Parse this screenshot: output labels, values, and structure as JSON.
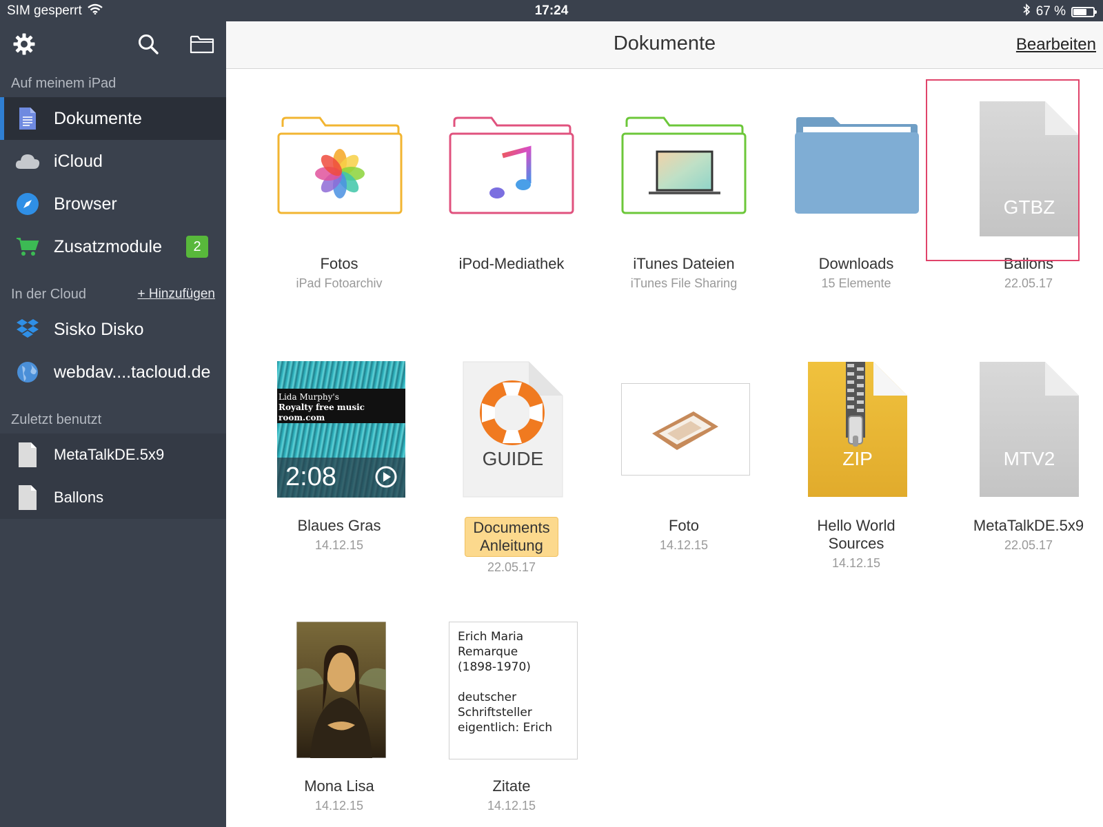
{
  "status_bar": {
    "carrier": "SIM gesperrt",
    "time": "17:24",
    "battery": "67 %",
    "battery_level": 0.67
  },
  "sidebar": {
    "section_local": "Auf meinem iPad",
    "items": [
      {
        "label": "Dokumente",
        "icon": "document-icon"
      },
      {
        "label": "iCloud",
        "icon": "cloud-icon"
      },
      {
        "label": "Browser",
        "icon": "compass-icon"
      },
      {
        "label": "Zusatzmodule",
        "icon": "cart-icon",
        "badge": "2"
      }
    ],
    "section_cloud": "In der Cloud",
    "add_label": "+ Hinzufügen",
    "cloud_items": [
      {
        "label": "Sisko Disko",
        "icon": "dropbox-icon"
      },
      {
        "label": "webdav....tacloud.de",
        "icon": "globe-icon"
      }
    ],
    "section_recent": "Zuletzt benutzt",
    "recent_items": [
      {
        "label": "MetaTalkDE.5x9",
        "icon": "file-icon"
      },
      {
        "label": "Ballons",
        "icon": "file-icon"
      }
    ]
  },
  "header": {
    "title": "Dokumente",
    "edit_label": "Bearbeiten"
  },
  "files": [
    {
      "name": "Fotos",
      "sub": "iPad Fotoarchiv"
    },
    {
      "name": "iPod-Mediathek",
      "sub": ""
    },
    {
      "name": "iTunes Dateien",
      "sub": "iTunes File Sharing"
    },
    {
      "name": "Downloads",
      "sub": "15 Elemente"
    },
    {
      "name": "Ballons",
      "sub": "22.05.17",
      "ext": "GTBZ"
    },
    {
      "name": "Blaues Gras",
      "sub": "14.12.15",
      "thumb_line1": "Lida Murphy's",
      "thumb_line2": "Royalty free music room.com",
      "duration": "2:08"
    },
    {
      "name": "Documents Anleitung",
      "sub": "22.05.17",
      "ext": "GUIDE"
    },
    {
      "name": "Foto",
      "sub": "14.12.15"
    },
    {
      "name": "Hello World Sources",
      "sub": "14.12.15",
      "ext": "ZIP"
    },
    {
      "name": "MetaTalkDE.5x9",
      "sub": "22.05.17",
      "ext": "MTV2"
    },
    {
      "name": "Mona Lisa",
      "sub": "14.12.15"
    },
    {
      "name": "Zitate",
      "sub": "14.12.15",
      "preview": "Erich Maria\nRemarque\n(1898-1970)\n\ndeutscher\nSchriftsteller\neigentlich: Erich"
    }
  ]
}
